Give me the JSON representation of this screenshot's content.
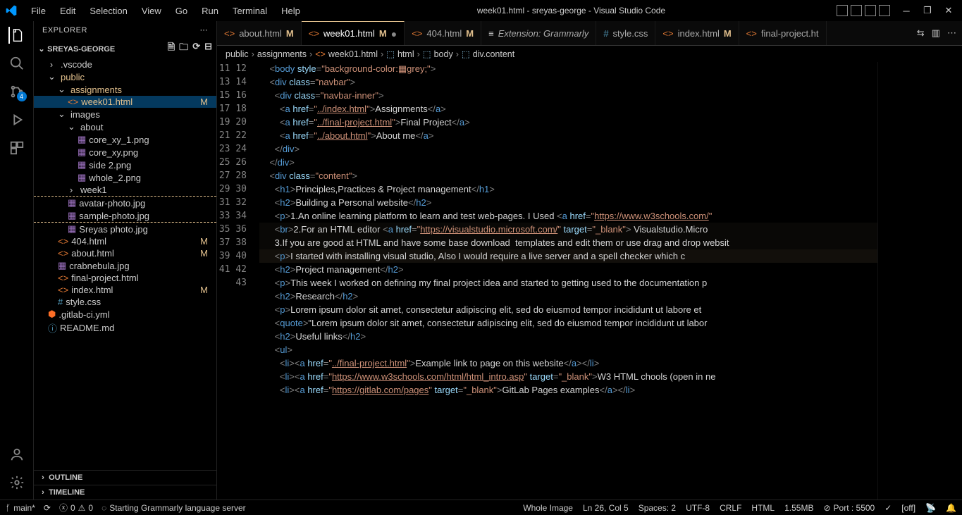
{
  "title": "week01.html - sreyas-george - Visual Studio Code",
  "menu": [
    "File",
    "Edit",
    "Selection",
    "View",
    "Go",
    "Run",
    "Terminal",
    "Help"
  ],
  "explorer": {
    "title": "EXPLORER",
    "workspace": "SREYAS-GEORGE",
    "tree": [
      {
        "d": 1,
        "t": "chev",
        "label": ".vscode",
        "kind": "folder",
        "open": false
      },
      {
        "d": 1,
        "t": "chev",
        "label": "public",
        "kind": "folder",
        "open": true,
        "hl": true
      },
      {
        "d": 2,
        "t": "chev",
        "label": "assignments",
        "kind": "folder",
        "open": true,
        "hl": true
      },
      {
        "d": 3,
        "t": "file",
        "label": "week01.html",
        "kind": "html",
        "mod": "M",
        "hl": true,
        "sel": true
      },
      {
        "d": 2,
        "t": "chev",
        "label": "images",
        "kind": "folder",
        "open": true
      },
      {
        "d": 3,
        "t": "chev",
        "label": "about",
        "kind": "folder",
        "open": true
      },
      {
        "d": 4,
        "t": "file",
        "label": "core_xy_1.png",
        "kind": "img"
      },
      {
        "d": 4,
        "t": "file",
        "label": "core_xy.png",
        "kind": "img"
      },
      {
        "d": 4,
        "t": "file",
        "label": "side 2.png",
        "kind": "img"
      },
      {
        "d": 4,
        "t": "file",
        "label": "whole_2.png",
        "kind": "img"
      },
      {
        "d": 3,
        "t": "chev",
        "label": "week1",
        "kind": "folder",
        "open": false
      },
      {
        "d": 3,
        "t": "file",
        "label": "avatar-photo.jpg",
        "kind": "img",
        "dashedTop": true
      },
      {
        "d": 3,
        "t": "file",
        "label": "sample-photo.jpg",
        "kind": "img",
        "dashedBottom": true
      },
      {
        "d": 3,
        "t": "file",
        "label": "Sreyas photo.jpg",
        "kind": "img"
      },
      {
        "d": 2,
        "t": "file",
        "label": "404.html",
        "kind": "html",
        "mod": "M"
      },
      {
        "d": 2,
        "t": "file",
        "label": "about.html",
        "kind": "html",
        "mod": "M"
      },
      {
        "d": 2,
        "t": "file",
        "label": "crabnebula.jpg",
        "kind": "img"
      },
      {
        "d": 2,
        "t": "file",
        "label": "final-project.html",
        "kind": "html"
      },
      {
        "d": 2,
        "t": "file",
        "label": "index.html",
        "kind": "html",
        "mod": "M"
      },
      {
        "d": 2,
        "t": "file",
        "label": "style.css",
        "kind": "css"
      },
      {
        "d": 1,
        "t": "file",
        "label": ".gitlab-ci.yml",
        "kind": "yml"
      },
      {
        "d": 1,
        "t": "file",
        "label": "README.md",
        "kind": "md"
      }
    ],
    "outline": "OUTLINE",
    "timeline": "TIMELINE"
  },
  "tabs": [
    {
      "icon": "html",
      "label": "about.html",
      "mod": "M"
    },
    {
      "icon": "html",
      "label": "week01.html",
      "mod": "M",
      "active": true,
      "dirty": true
    },
    {
      "icon": "html",
      "label": "404.html",
      "mod": "M"
    },
    {
      "icon": "ext",
      "label": "Extension: Grammarly",
      "italic": true
    },
    {
      "icon": "css",
      "label": "style.css"
    },
    {
      "icon": "html",
      "label": "index.html",
      "mod": "M"
    },
    {
      "icon": "html",
      "label": "final-project.ht"
    }
  ],
  "breadcrumb": [
    "public",
    "assignments",
    "week01.html",
    "html",
    "body",
    "div.content"
  ],
  "lines_start": 11,
  "lines_end": 43,
  "statusbar": {
    "branch": "main*",
    "sync": "",
    "errors": "0",
    "warnings": "0",
    "grammarly": "Starting Grammarly language server",
    "wholeimage": "Whole Image",
    "lncol": "Ln 26, Col 5",
    "spaces": "Spaces: 2",
    "encoding": "UTF-8",
    "eol": "CRLF",
    "lang": "HTML",
    "size": "1.55MB",
    "port": "Port : 5500",
    "off": "[off]"
  },
  "scm_badge": "4"
}
